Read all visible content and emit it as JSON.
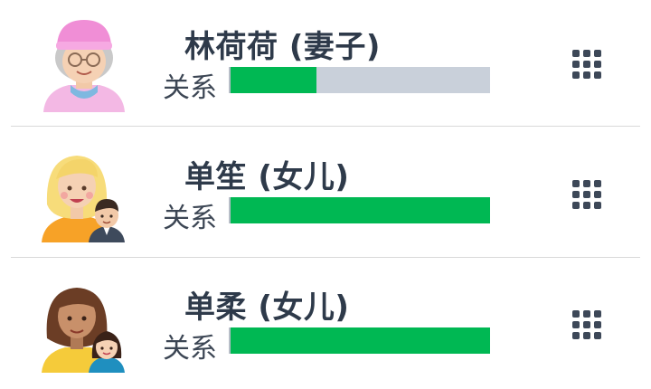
{
  "members": [
    {
      "name": "林荷荷 (妻子)",
      "relation_label": "关系",
      "relation_level": 0.33,
      "avatar": "elderly-woman-pink-hat-avatar"
    },
    {
      "name": "单笙 (女儿)",
      "relation_label": "关系",
      "relation_level": 1.0,
      "avatar": "blonde-woman-with-man-avatar"
    },
    {
      "name": "单柔 (女儿)",
      "relation_label": "关系",
      "relation_level": 1.0,
      "avatar": "brunette-woman-with-girl-avatar"
    }
  ],
  "colors": {
    "bar_fill": "#00b853",
    "bar_track": "#c9d0da",
    "text": "#2e3a4a",
    "menu_icon": "#3d4858"
  },
  "icons": {
    "menu": "grid-dots-icon"
  }
}
